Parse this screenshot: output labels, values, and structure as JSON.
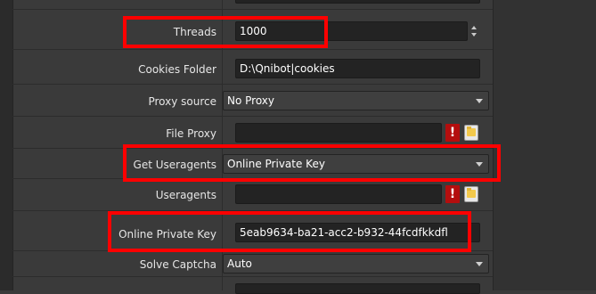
{
  "rows": [
    {
      "label": "Threads",
      "value": "1000"
    },
    {
      "label": "Cookies Folder",
      "value": "D:\\Qnibot|cookies"
    },
    {
      "label": "Proxy source",
      "value": "No Proxy"
    },
    {
      "label": "File Proxy",
      "value": ""
    },
    {
      "label": "Get Useragents",
      "value": "Online Private Key"
    },
    {
      "label": "Useragents",
      "value": ""
    },
    {
      "label": "Online Private Key",
      "value": "5eab9634-ba21-acc2-b932-44fcdfkkdfl"
    },
    {
      "label": "Solve Captcha",
      "value": "Auto"
    }
  ],
  "icons": {
    "warning": "!",
    "folder": "folder-icon"
  },
  "colors": {
    "highlight": "#ff0000",
    "warning_bg": "#b40e0e"
  }
}
